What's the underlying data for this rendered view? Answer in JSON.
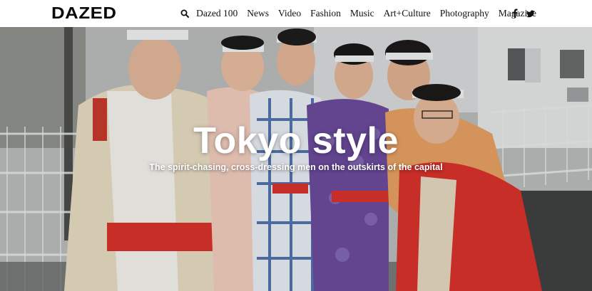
{
  "header": {
    "logo": "DAZED",
    "nav": [
      "Dazed 100",
      "News",
      "Video",
      "Fashion",
      "Music",
      "Art+Culture",
      "Photography",
      "Magazine"
    ],
    "search_icon": "search-icon",
    "social": [
      {
        "name": "facebook",
        "glyph": "f"
      },
      {
        "name": "twitter",
        "glyph": "twitter-bird"
      }
    ]
  },
  "hero": {
    "title": "Tokyo style",
    "subtitle": "The spirit-chasing, cross-dressing men on the outskirts of the capital",
    "image": "Group of young men in colourful kimono with hachimaki headbands posing outside a house with a metal fence"
  },
  "colors": {
    "text": "#111111",
    "hero_text": "#ffffff",
    "sash_red": "#d8322b",
    "kimono_purple": "#6b4a9c",
    "kimono_blue": "#3a5fa0"
  }
}
